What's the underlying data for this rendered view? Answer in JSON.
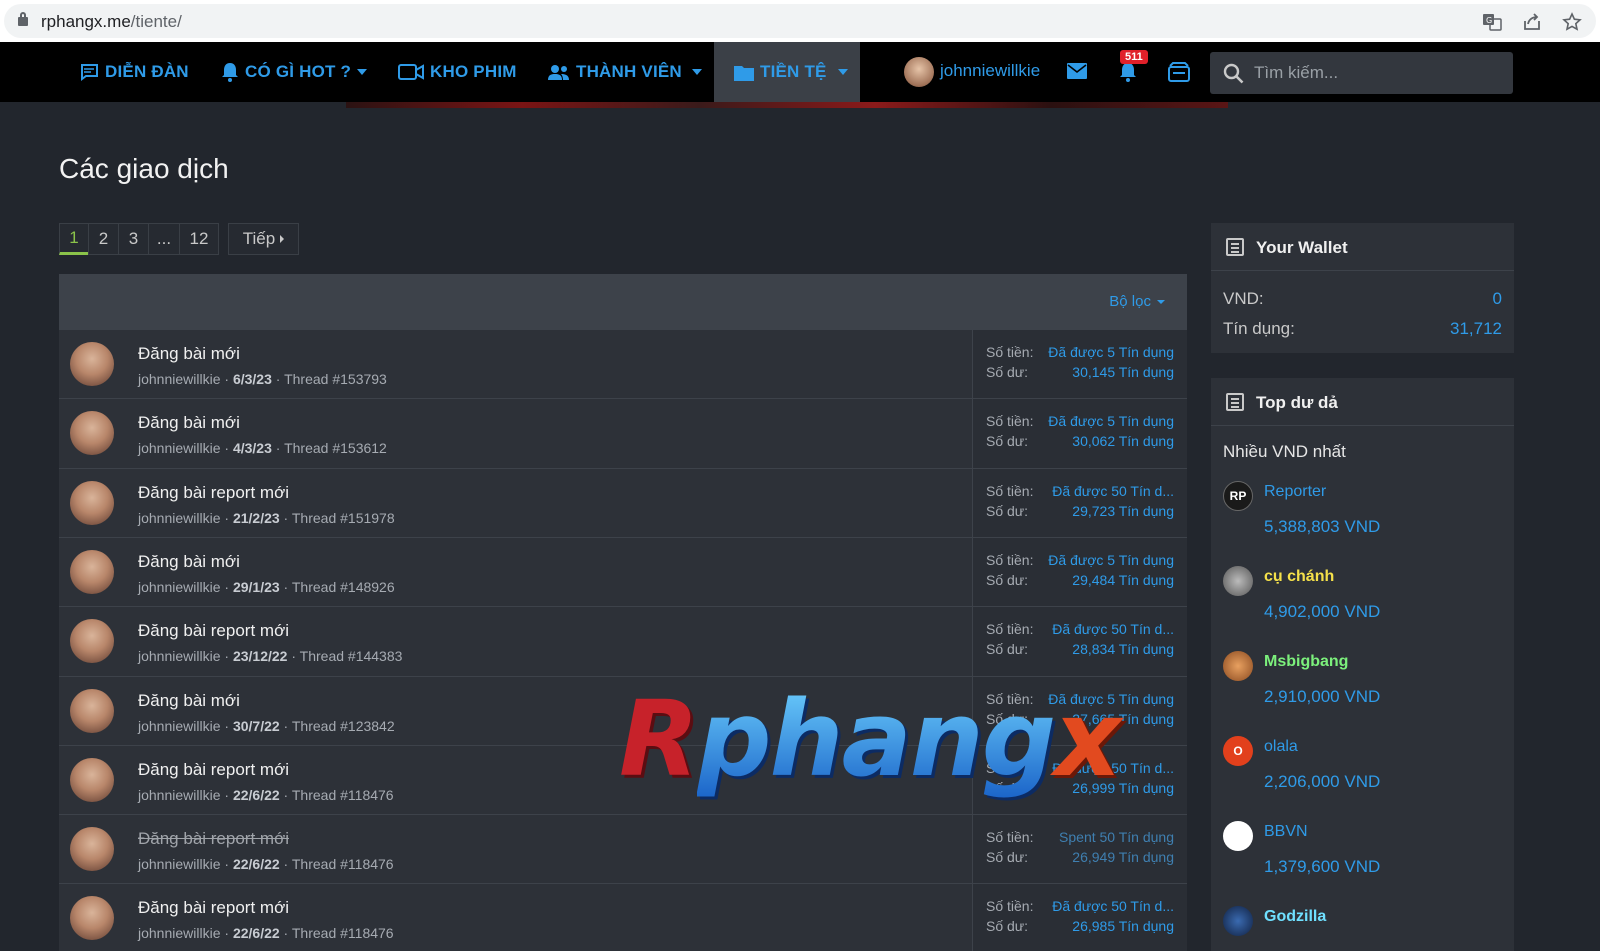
{
  "browser": {
    "url_domain": "rphangx.me",
    "url_path": "/tiente/",
    "icons": [
      "translate-icon",
      "share-icon",
      "bookmark-star-icon"
    ]
  },
  "nav": {
    "items": [
      {
        "label": "DIỄN ĐÀN",
        "icon": "forum-icon"
      },
      {
        "label": "CÓ GÌ HOT ?",
        "icon": "bell-icon"
      },
      {
        "label": "KHO PHIM",
        "icon": "video-icon"
      },
      {
        "label": "THÀNH VIÊN",
        "icon": "members-icon"
      },
      {
        "label": "TIỀN TỆ",
        "icon": "folder-icon"
      }
    ],
    "username": "johnniewillkie",
    "notification_count": "511",
    "search_placeholder": "Tìm kiếm..."
  },
  "page": {
    "title": "Các giao dịch",
    "pagination": {
      "pages": [
        "1",
        "2",
        "3",
        "...",
        "12"
      ],
      "current": "1",
      "next": "Tiếp"
    },
    "filter_label": "Bộ lọc",
    "watermark": {
      "r": "R",
      "mid": "phang",
      "x": "x"
    }
  },
  "transactions": [
    {
      "title": "Đăng bài mới",
      "user": "johnniewillkie",
      "date": "6/3/23",
      "thread": "Thread #153793",
      "amount_label": "Số tiền:",
      "amount": "Đã được 5 Tín dụng",
      "balance_label": "Số dư:",
      "balance": "30,145 Tín dụng",
      "undone": false
    },
    {
      "title": "Đăng bài mới",
      "user": "johnniewillkie",
      "date": "4/3/23",
      "thread": "Thread #153612",
      "amount_label": "Số tiền:",
      "amount": "Đã được 5 Tín dụng",
      "balance_label": "Số dư:",
      "balance": "30,062 Tín dụng",
      "undone": false
    },
    {
      "title": "Đăng bài report mới",
      "user": "johnniewillkie",
      "date": "21/2/23",
      "thread": "Thread #151978",
      "amount_label": "Số tiền:",
      "amount": "Đã được 50 Tín d...",
      "balance_label": "Số dư:",
      "balance": "29,723 Tín dụng",
      "undone": false
    },
    {
      "title": "Đăng bài mới",
      "user": "johnniewillkie",
      "date": "29/1/23",
      "thread": "Thread #148926",
      "amount_label": "Số tiền:",
      "amount": "Đã được 5 Tín dụng",
      "balance_label": "Số dư:",
      "balance": "29,484 Tín dụng",
      "undone": false
    },
    {
      "title": "Đăng bài report mới",
      "user": "johnniewillkie",
      "date": "23/12/22",
      "thread": "Thread #144383",
      "amount_label": "Số tiền:",
      "amount": "Đã được 50 Tín d...",
      "balance_label": "Số dư:",
      "balance": "28,834 Tín dụng",
      "undone": false
    },
    {
      "title": "Đăng bài mới",
      "user": "johnniewillkie",
      "date": "30/7/22",
      "thread": "Thread #123842",
      "amount_label": "Số tiền:",
      "amount": "Đã được 5 Tín dụng",
      "balance_label": "Số dư:",
      "balance": "27,665 Tín dụng",
      "undone": false
    },
    {
      "title": "Đăng bài report mới",
      "user": "johnniewillkie",
      "date": "22/6/22",
      "thread": "Thread #118476",
      "amount_label": "Số tiền:",
      "amount": "Đã được 50 Tín d...",
      "balance_label": "Số dư:",
      "balance": "26,999 Tín dụng",
      "undone": false
    },
    {
      "title": "Đăng bài report mới",
      "user": "johnniewillkie",
      "date": "22/6/22",
      "thread": "Thread #118476",
      "amount_label": "Số tiền:",
      "amount": "Spent 50 Tín dụng",
      "balance_label": "Số dư:",
      "balance": "26,949 Tín dụng",
      "undone": true
    },
    {
      "title": "Đăng bài report mới",
      "user": "johnniewillkie",
      "date": "22/6/22",
      "thread": "Thread #118476",
      "amount_label": "Số tiền:",
      "amount": "Đã được 50 Tín d...",
      "balance_label": "Số dư:",
      "balance": "26,985 Tín dụng",
      "undone": false
    }
  ],
  "wallet": {
    "title": "Your Wallet",
    "rows": [
      {
        "key": "VND:",
        "value": "0"
      },
      {
        "key": "Tín dụng:",
        "value": "31,712"
      }
    ]
  },
  "top": {
    "title": "Top dư dả",
    "subtitle": "Nhiều VND nhất",
    "users": [
      {
        "name": "Reporter",
        "amount": "5,388,803 VND",
        "color": "#2f9be8",
        "avatar_text": "RP"
      },
      {
        "name": "cụ chánh",
        "amount": "4,902,000 VND",
        "color": "#f5e14a",
        "avatar_text": ""
      },
      {
        "name": "Msbigbang",
        "amount": "2,910,000 VND",
        "color": "#7cf07c",
        "avatar_text": ""
      },
      {
        "name": "olala",
        "amount": "2,206,000 VND",
        "color": "#2f9be8",
        "avatar_text": "O"
      },
      {
        "name": "BBVN",
        "amount": "1,379,600 VND",
        "color": "#2f9be8",
        "avatar_text": ""
      },
      {
        "name": "Godzilla",
        "amount": "",
        "color": "#6fe0ff",
        "avatar_text": ""
      }
    ]
  }
}
